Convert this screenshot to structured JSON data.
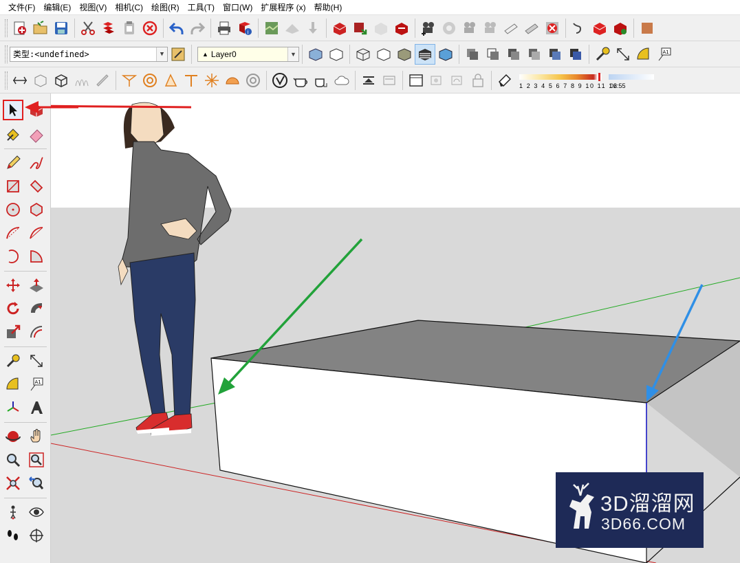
{
  "menu": [
    "文件(F)",
    "编辑(E)",
    "视图(V)",
    "相机(C)",
    "绘图(R)",
    "工具(T)",
    "窗口(W)",
    "扩展程序 (x)",
    "帮助(H)"
  ],
  "entity_info": {
    "type_label": "类型:",
    "type_value": "<undefined>",
    "layer_value": "Layer0"
  },
  "shadow": {
    "month_ticks": "1 2 3 4 5 6 7 8 9 10 11 12",
    "time": "06:55",
    "gradient_colors": [
      "#ffffff",
      "#f6c44a",
      "#e8872c",
      "#c72a1f"
    ]
  },
  "watermark": {
    "line1": "3D溜溜网",
    "line2": "3D66.COM",
    "background": "#1e2a57"
  },
  "colors": {
    "sky": "#ffffff",
    "ground": "#d9d9d9",
    "box_front": "#ffffff",
    "box_top": "#838383",
    "box_side": "#c4c4c4",
    "red_axis": "#cc2222",
    "green_axis": "#22aa22",
    "blue_axis": "#1c1cd0",
    "red_arrow": "#e02020",
    "green_arrow": "#22a23a",
    "blue_arrow": "#2f8fe6"
  },
  "tools": {
    "toolbar_row1": [
      "new-icon",
      "open-icon",
      "save-icon",
      "cut-icon",
      "copy-icon",
      "paste-icon",
      "erase-icon",
      "undo-icon",
      "redo-icon",
      "print-icon",
      "model-info-icon"
    ],
    "left": [
      "select",
      "make-component",
      "paint-bucket",
      "eraser",
      "pencil",
      "freehand",
      "rectangle",
      "rotated-rectangle",
      "circle",
      "polygon",
      "arc",
      "pie",
      "move",
      "push-pull",
      "rotate",
      "follow-me",
      "scale",
      "offset",
      "tape-measure",
      "dimension",
      "protractor",
      "text",
      "axes",
      "3d-text",
      "orbit",
      "pan",
      "zoom",
      "zoom-window",
      "zoom-extents",
      "previous",
      "position-camera",
      "look-around",
      "walk",
      "section-plane"
    ]
  }
}
